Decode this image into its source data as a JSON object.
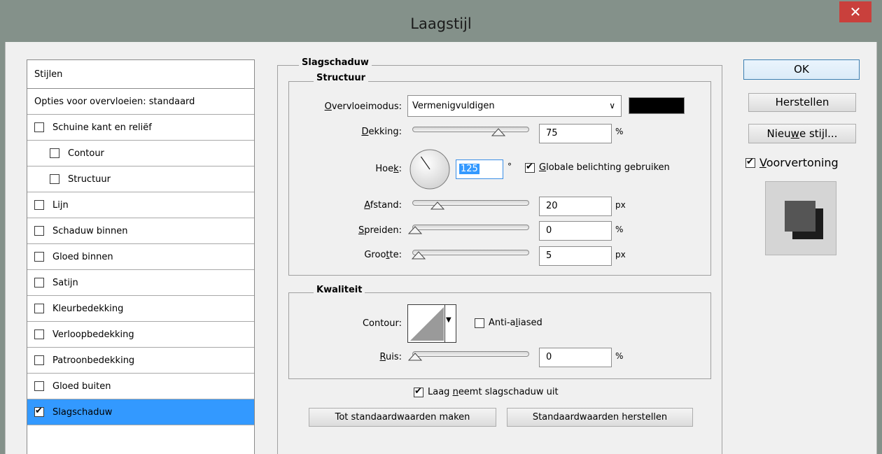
{
  "window": {
    "title": "Laagstijl",
    "close_glyph": "✕"
  },
  "styles_list": [
    {
      "label": "Stijlen",
      "checkbox": false,
      "checked": false,
      "indent": 0
    },
    {
      "label": "Opties voor overvloeien: standaard",
      "checkbox": false,
      "checked": false,
      "indent": 0
    },
    {
      "label": "Schuine kant en reliëf",
      "checkbox": true,
      "checked": false,
      "indent": 0
    },
    {
      "label": "Contour",
      "checkbox": true,
      "checked": false,
      "indent": 1
    },
    {
      "label": "Structuur",
      "checkbox": true,
      "checked": false,
      "indent": 1
    },
    {
      "label": "Lijn",
      "checkbox": true,
      "checked": false,
      "indent": 0
    },
    {
      "label": "Schaduw binnen",
      "checkbox": true,
      "checked": false,
      "indent": 0
    },
    {
      "label": "Gloed binnen",
      "checkbox": true,
      "checked": false,
      "indent": 0
    },
    {
      "label": "Satijn",
      "checkbox": true,
      "checked": false,
      "indent": 0
    },
    {
      "label": "Kleurbedekking",
      "checkbox": true,
      "checked": false,
      "indent": 0
    },
    {
      "label": "Verloopbedekking",
      "checkbox": true,
      "checked": false,
      "indent": 0
    },
    {
      "label": "Patroonbedekking",
      "checkbox": true,
      "checked": false,
      "indent": 0
    },
    {
      "label": "Gloed buiten",
      "checkbox": true,
      "checked": false,
      "indent": 0
    },
    {
      "label": "Slagschaduw",
      "checkbox": true,
      "checked": true,
      "indent": 0,
      "selected": true
    }
  ],
  "panel": {
    "title": "Slagschaduw",
    "structure": {
      "title": "Structuur",
      "blend_mode": {
        "label_u": "O",
        "label_rest": "vervloeimodus:",
        "value": "Vermenigvuldigen",
        "color": "#000000"
      },
      "opacity": {
        "label_u": "D",
        "label_rest": "ekking:",
        "value": "75",
        "unit": "%",
        "fraction": 0.75
      },
      "angle": {
        "label_pre": "Hoe",
        "label_u": "k",
        "label_post": ":",
        "value": "125",
        "unit": "°",
        "degrees": 125
      },
      "global_light": {
        "label_u": "G",
        "label_rest": "lobale belichting gebruiken",
        "checked": true
      },
      "distance": {
        "label_u": "A",
        "label_rest": "fstand:",
        "value": "20",
        "unit": "px",
        "fraction": 0.2
      },
      "spread": {
        "label_u": "S",
        "label_rest": "preiden:",
        "value": "0",
        "unit": "%",
        "fraction": 0
      },
      "size": {
        "label_pre": "Groo",
        "label_u": "t",
        "label_post": "te:",
        "value": "5",
        "unit": "px",
        "fraction": 0.03
      }
    },
    "quality": {
      "title": "Kwaliteit",
      "contour_label": "Contour:",
      "anti_aliased": {
        "label_pre": "Anti-a",
        "label_u": "l",
        "label_post": "iased",
        "checked": false
      },
      "noise": {
        "label_u": "R",
        "label_rest": "uis:",
        "value": "0",
        "unit": "%",
        "fraction": 0
      }
    },
    "knockout": {
      "label_pre": "Laag ",
      "label_u": "n",
      "label_post": "eemt slagschaduw uit",
      "checked": true
    },
    "make_default_label": "Tot standaardwaarden maken",
    "reset_default_label": "Standaardwaarden herstellen"
  },
  "actions": {
    "ok_label": "OK",
    "reset_label": "Herstellen",
    "new_style_pre": "Nieu",
    "new_style_u": "w",
    "new_style_post": "e stijl...",
    "preview_u": "V",
    "preview_rest": "oorvertoning",
    "preview_checked": true
  }
}
